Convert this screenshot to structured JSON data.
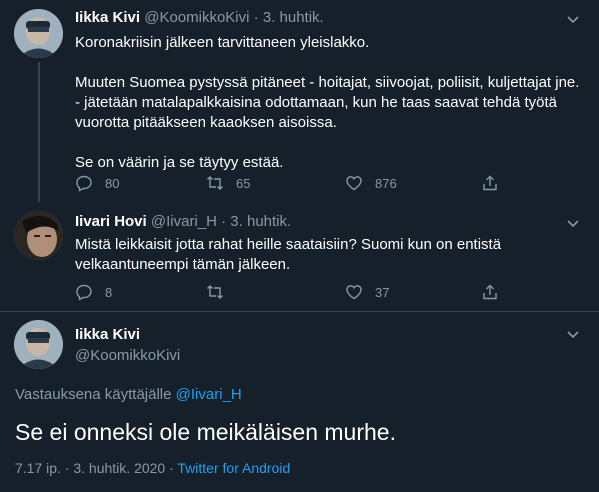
{
  "tweet1": {
    "name": "Iikka Kivi",
    "handle": "@KoomikkoKivi",
    "sep": "·",
    "date": "3. huhtik.",
    "text": "Koronakriisin jälkeen tarvittaneen yleislakko.\n\nMuuten Suomea pystyssä pitäneet - hoitajat, siivoojat, poliisit, kuljettajat jne. - jätetään matalapalkkaisina odottamaan, kun he taas saavat tehdä työtä vuorotta pitääkseen kaaoksen aisoissa.\n\nSe on väärin ja se täytyy estää.",
    "replies": "80",
    "retweets": "65",
    "likes": "876"
  },
  "tweet2": {
    "name": "Iivari Hovi",
    "handle": "@Iivari_H",
    "sep": "·",
    "date": "3. huhtik.",
    "text": "Mistä leikkaisit jotta rahat heille saataisiin? Suomi kun on entistä velkaantuneempi tämän jälkeen.",
    "replies": "8",
    "retweets": "",
    "likes": "37"
  },
  "main_tweet": {
    "name": "Iikka Kivi",
    "handle": "@KoomikkoKivi",
    "reply_prefix": "Vastauksena käyttäjälle",
    "reply_to": "@Iivari_H",
    "text": "Se ei onneksi ole meikäläisen murhe.",
    "timestamp": "7.17 ip. · 3. huhtik. 2020 ·",
    "source": "Twitter for Android"
  },
  "colors": {
    "background": "#15202b",
    "muted": "#8899a6",
    "link": "#1da1f2",
    "divider": "#38444d"
  }
}
